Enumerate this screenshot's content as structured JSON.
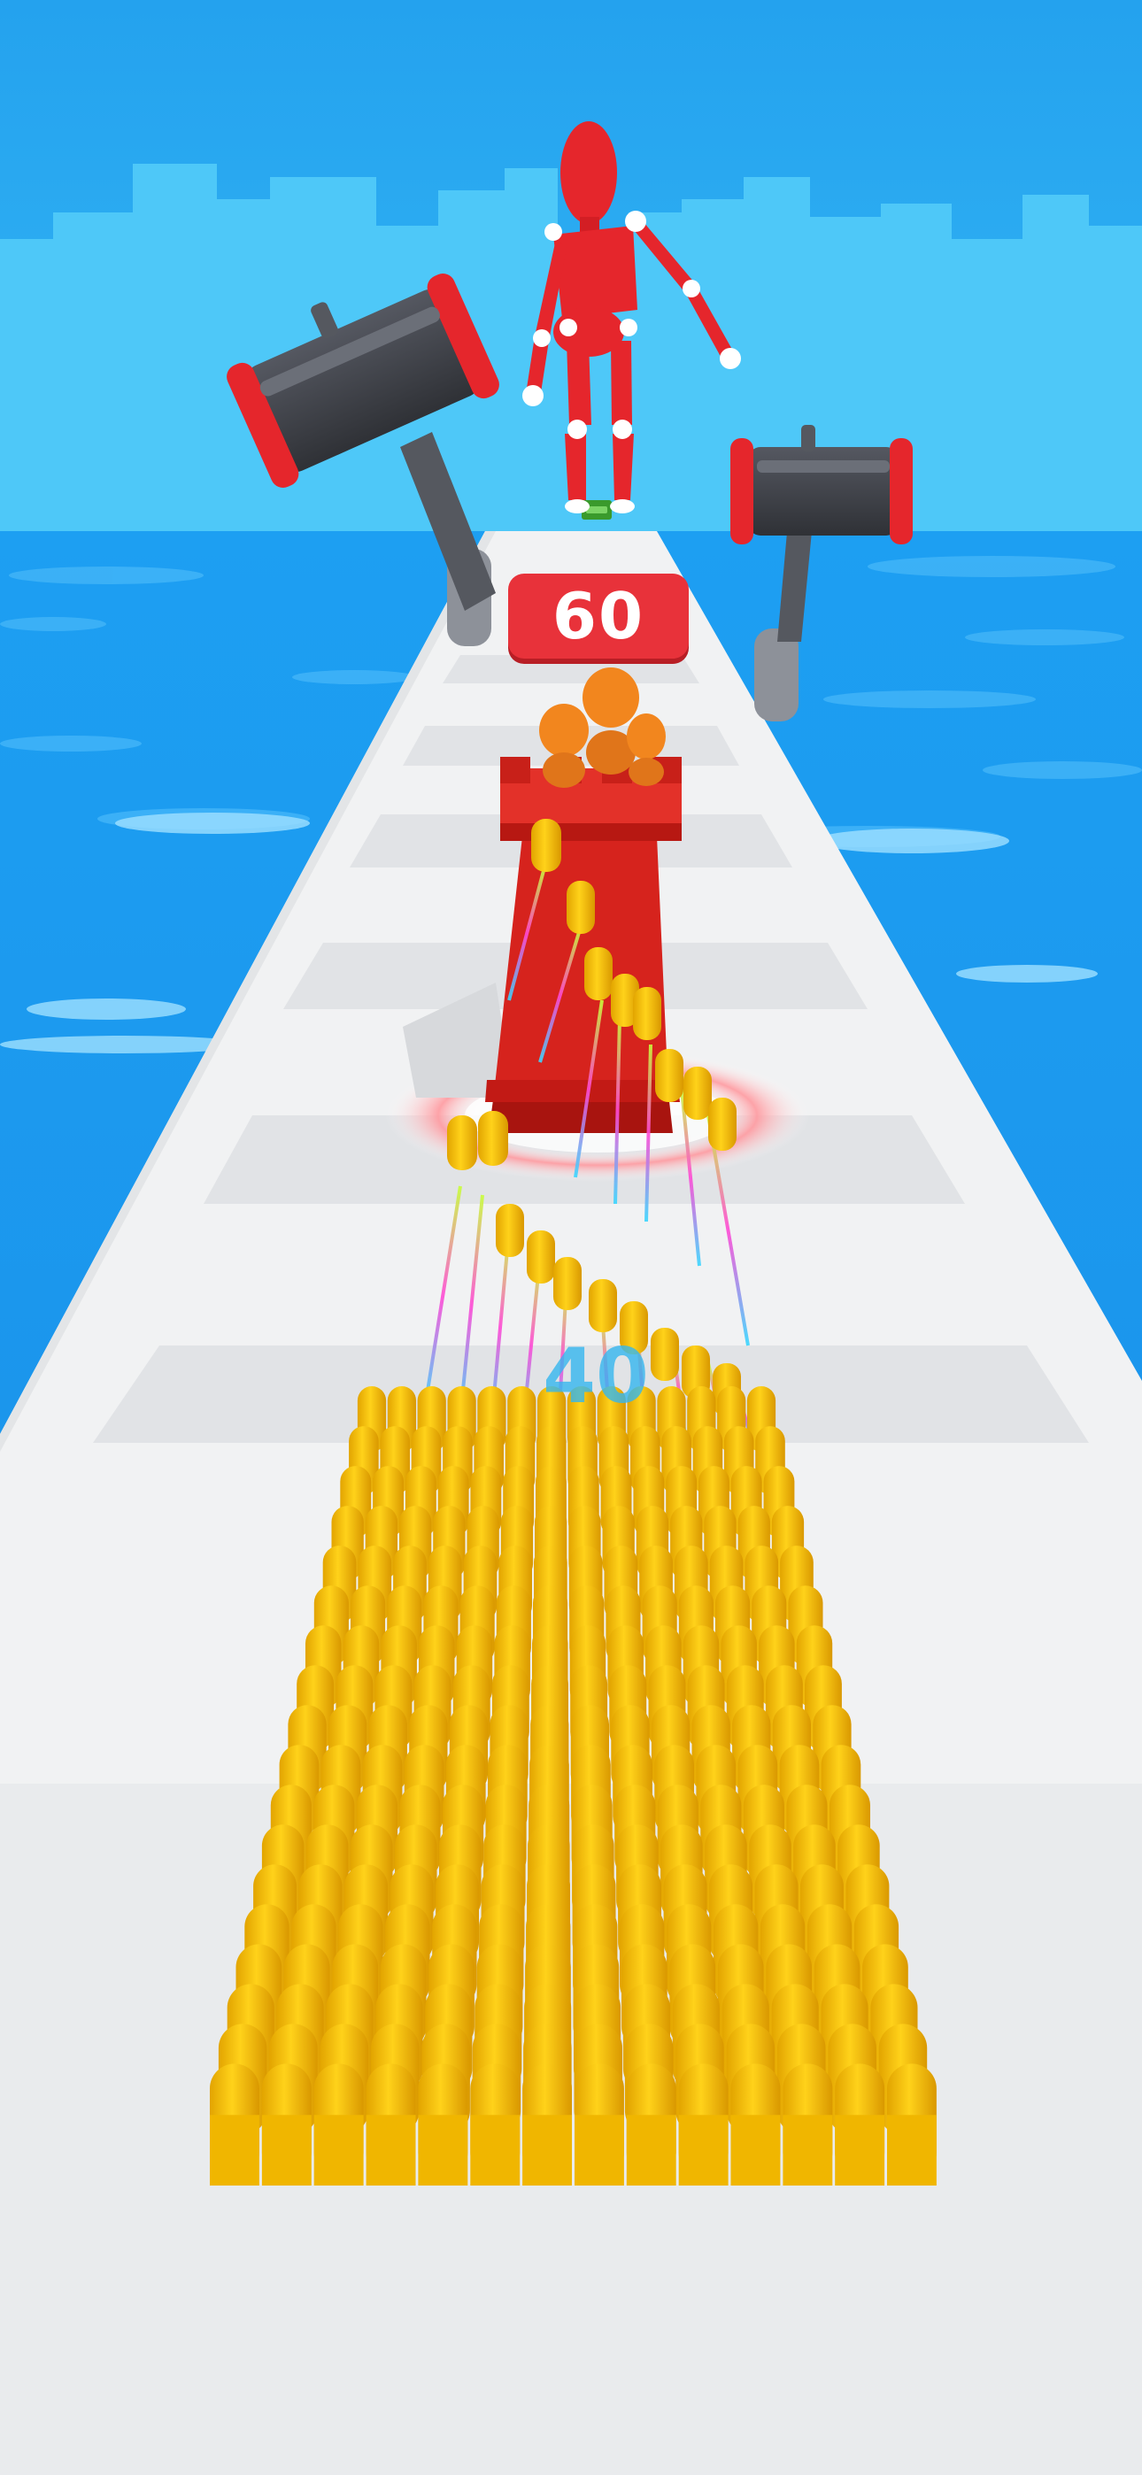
{
  "game": {
    "enemy_health": "60",
    "floor_number": "40"
  },
  "colors": {
    "sky": "#27a6f0",
    "water": "#1e9cf2",
    "track": "#f2f3f4",
    "boss": "#e5262c",
    "tower": "#d8241e",
    "bullet": "#f6c000",
    "hammer": "#3f4147"
  },
  "icons": {
    "boss": "red-stickman-boss",
    "hammer": "hammer-obstacle",
    "tower": "castle-tower",
    "bullets": "bullet-army",
    "cash": "cash-stack-icon"
  }
}
